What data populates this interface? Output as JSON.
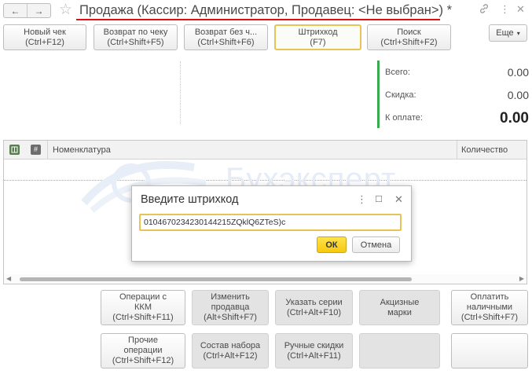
{
  "window": {
    "title": "Продажа (Кассир: Администратор, Продавец: <Не выбран>) *",
    "nav_back": "←",
    "nav_forward": "→",
    "star": "☆",
    "link_icon": "🔗",
    "menu_icon": "⋮",
    "close_icon": "✕"
  },
  "toolbar": {
    "buttons": [
      {
        "line1": "Новый чек",
        "line2": "(Ctrl+F12)"
      },
      {
        "line1": "Возврат по чеку",
        "line2": "(Ctrl+Shift+F5)"
      },
      {
        "line1": "Возврат без ч...",
        "line2": "(Ctrl+Shift+F6)"
      },
      {
        "line1": "Штрихкод",
        "line2": "(F7)"
      },
      {
        "line1": "Поиск",
        "line2": "(Ctrl+Shift+F2)"
      }
    ],
    "more_label": "Еще",
    "more_arrow": "▾"
  },
  "totals": {
    "total_label": "Всего:",
    "total_value": "0.00",
    "discount_label": "Скидка:",
    "discount_value": "0.00",
    "to_pay_label": "К оплате:",
    "to_pay_value": "0.00"
  },
  "table": {
    "col_num": "#",
    "col_nomenclature": "Номенклатура",
    "col_quantity": "Количество"
  },
  "watermark": {
    "text": "Бухэксперт"
  },
  "dialog": {
    "title": "Введите штрихкод",
    "menu_icon": "⋮",
    "maximize_icon": "☐",
    "close_icon": "✕",
    "input_value": "0104670234230144215ZQklQ6ZTeS)c",
    "ok_label": "ОК",
    "cancel_label": "Отмена"
  },
  "bottom_buttons": {
    "kkm": {
      "line1": "Операции с",
      "line2": "ККМ",
      "line3": "(Ctrl+Shift+F11)"
    },
    "change_seller": {
      "line1": "Изменить",
      "line2": "продавца",
      "line3": "(Alt+Shift+F7)"
    },
    "series": {
      "line1": "Указать серии",
      "line2": "(Ctrl+Alt+F10)"
    },
    "excise": {
      "line1": "Акцизные",
      "line2": "марки"
    },
    "pay_cash": {
      "line1": "Оплатить",
      "line2": "наличными",
      "line3": "(Ctrl+Shift+F7)"
    },
    "other": {
      "line1": "Прочие",
      "line2": "операции",
      "line3": "(Ctrl+Shift+F12)"
    },
    "set_content": {
      "line1": "Состав набора",
      "line2": "(Ctrl+Alt+F12)"
    },
    "manual_discounts": {
      "line1": "Ручные скидки",
      "line2": "(Ctrl+Alt+F11)"
    }
  },
  "colors": {
    "accent_yellow": "#f5c90c",
    "totals_bar_green": "#3aaa4e",
    "title_underline_red": "#e01010"
  }
}
